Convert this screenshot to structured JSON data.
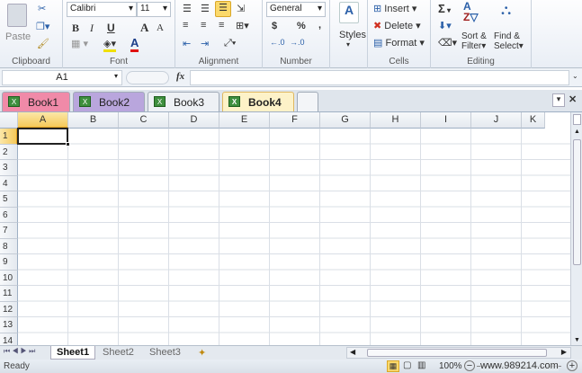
{
  "ribbon": {
    "clipboard": {
      "label": "Clipboard",
      "paste": "Paste"
    },
    "font": {
      "label": "Font",
      "name": "Calibri",
      "size": "11",
      "bold": "B",
      "italic": "I",
      "underline": "U",
      "grow": "A",
      "shrink": "A"
    },
    "alignment": {
      "label": "Alignment"
    },
    "number": {
      "label": "Number",
      "format": "General",
      "currency": "$",
      "percent": "%",
      "comma": ","
    },
    "styles": {
      "label": "Styles"
    },
    "cells": {
      "label": "Cells",
      "insert": "Insert",
      "delete": "Delete",
      "format": "Format"
    },
    "editing": {
      "label": "Editing",
      "sum": "Σ",
      "sort": "Sort &",
      "sort2": "Filter",
      "find": "Find &",
      "find2": "Select"
    }
  },
  "formula_bar": {
    "name_box": "A1",
    "fx": "fx",
    "value": ""
  },
  "workbooks": [
    {
      "label": "Book1",
      "color": "#f08aa8"
    },
    {
      "label": "Book2",
      "color": "#b9a6dd"
    },
    {
      "label": "Book3",
      "color": "#eef1f5"
    },
    {
      "label": "Book4",
      "color": "#fdf2c8",
      "active": true
    }
  ],
  "close_tab": "×",
  "columns": [
    "A",
    "B",
    "C",
    "D",
    "E",
    "F",
    "G",
    "H",
    "I",
    "J",
    "K"
  ],
  "rows": [
    "1",
    "2",
    "3",
    "4",
    "5",
    "6",
    "7",
    "8",
    "9",
    "10",
    "11",
    "12",
    "13",
    "14"
  ],
  "selected_cell": "A1",
  "sheets": [
    {
      "label": "Sheet1",
      "active": true
    },
    {
      "label": "Sheet2"
    },
    {
      "label": "Sheet3"
    }
  ],
  "status": {
    "text": "Ready",
    "zoom": "100%"
  },
  "watermark": "www.989214.com"
}
